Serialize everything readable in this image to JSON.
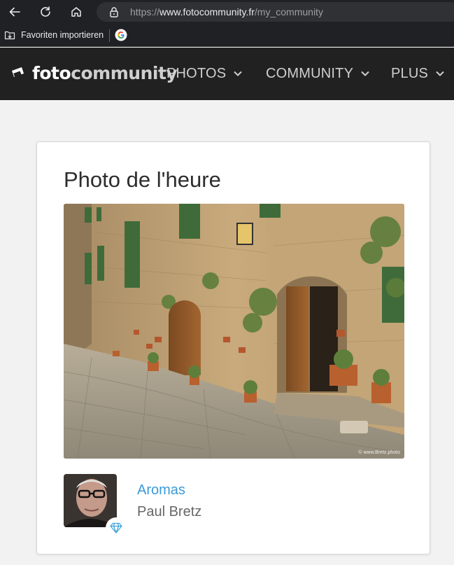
{
  "browser": {
    "url_scheme": "https://",
    "url_host": "www.fotocommunity.fr",
    "url_path": "/my_community",
    "bookmark_label": "Favoriten importieren"
  },
  "site": {
    "logo_part1": "foto",
    "logo_part2": "community",
    "menu": [
      {
        "label": "PHOTOS"
      },
      {
        "label": "COMMUNITY"
      },
      {
        "label": "PLUS"
      }
    ]
  },
  "card": {
    "title": "Photo de l'heure",
    "photo_credit": "© www.Bretz.photo",
    "photo_name": "Aromas",
    "author": "Paul Bretz"
  },
  "colors": {
    "header_bg": "#212121",
    "link": "#3a9ad9",
    "badge": "#3aa0d8"
  }
}
